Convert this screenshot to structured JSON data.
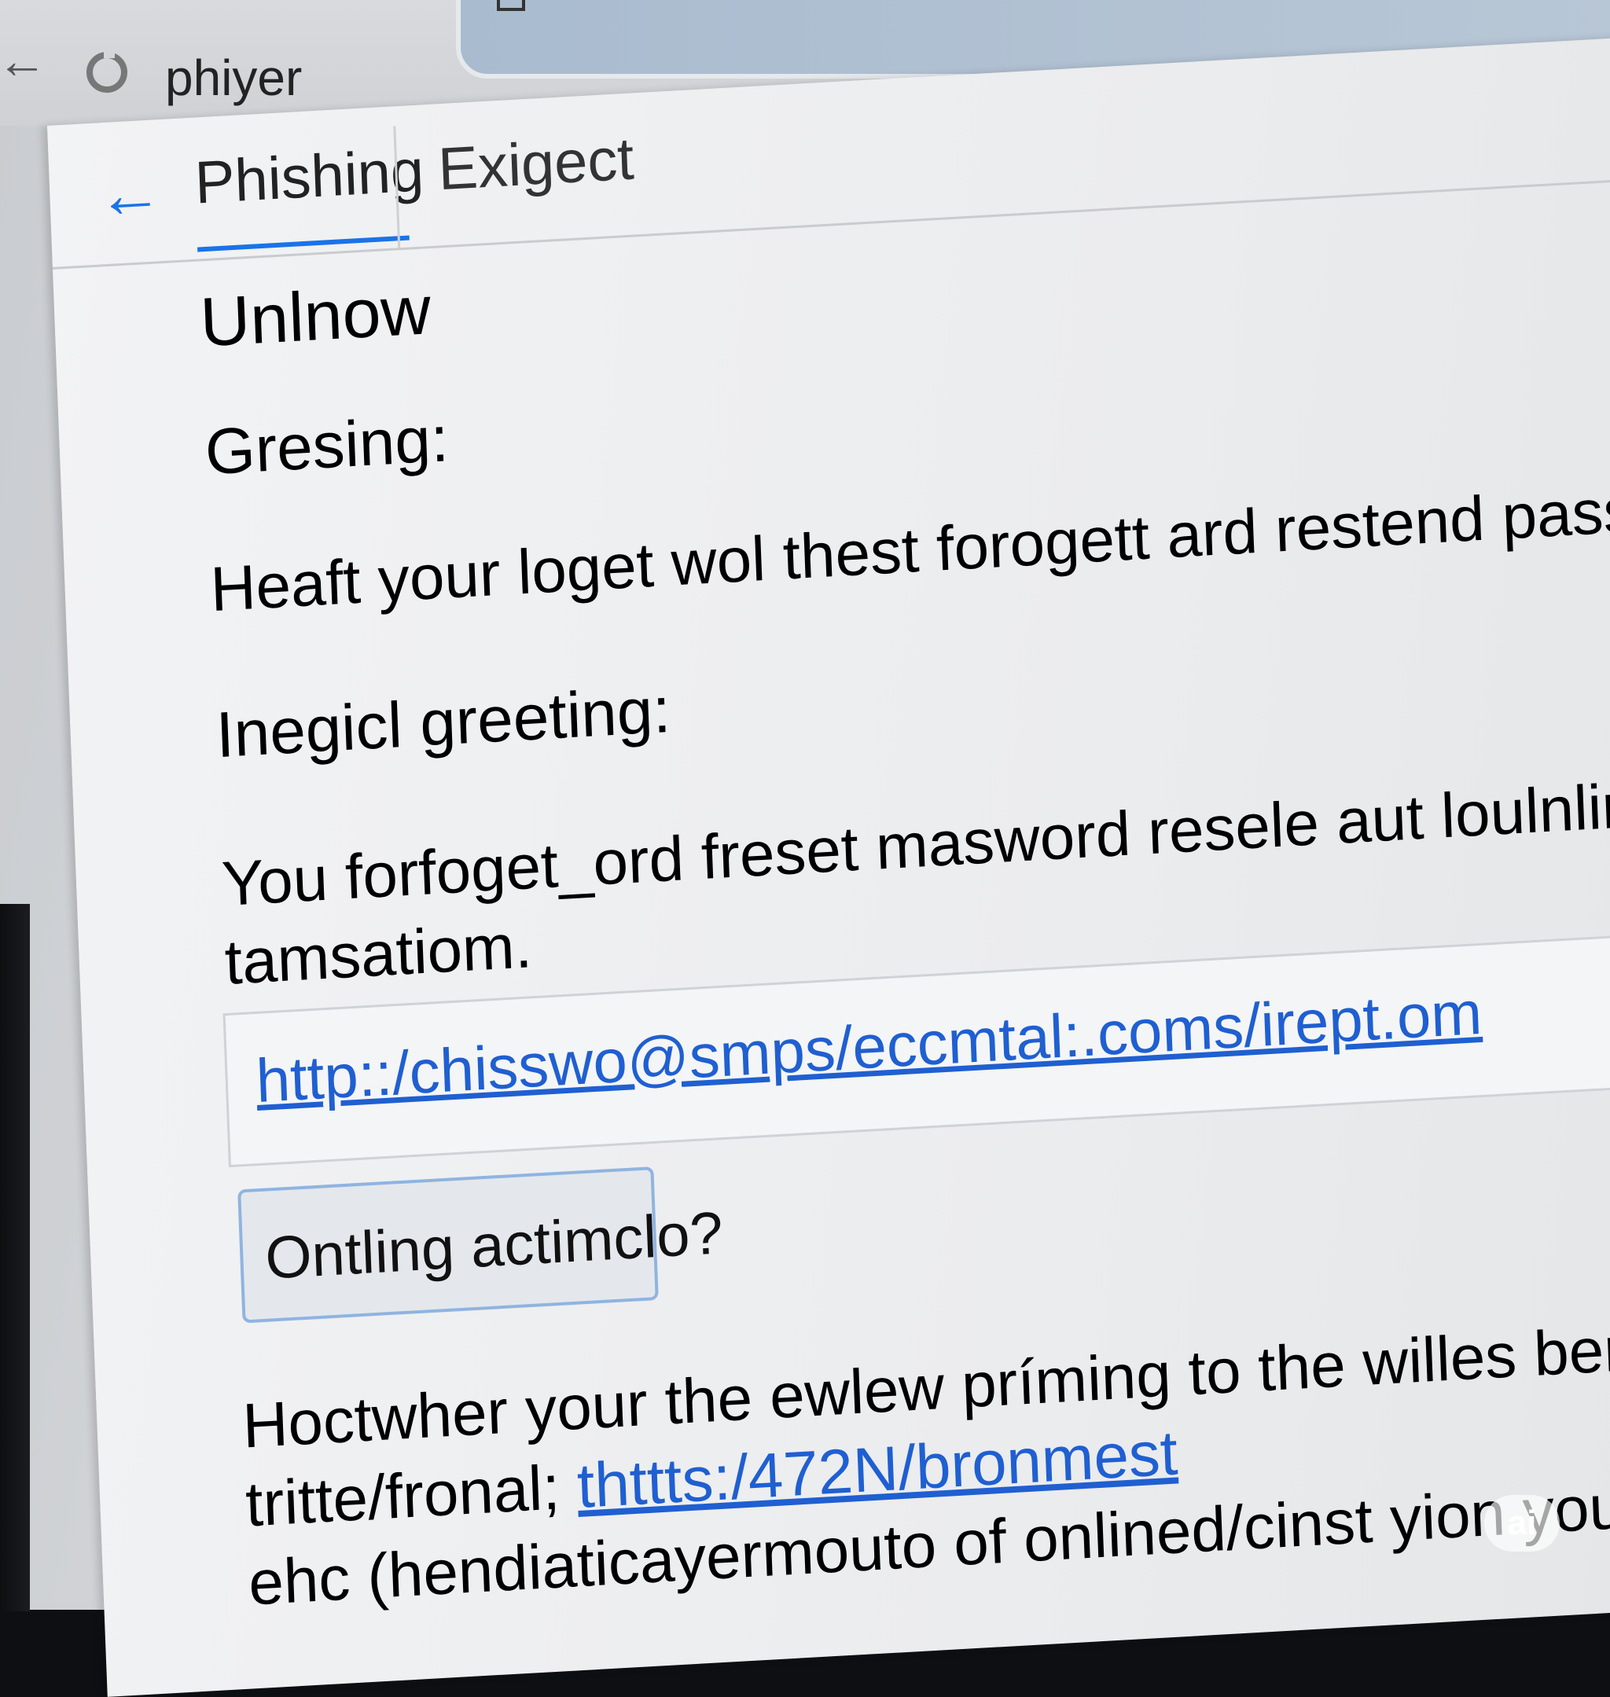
{
  "browser": {
    "address_text": "phiyer"
  },
  "mail": {
    "tabs": [
      {
        "label": "Phishing",
        "active": true
      },
      {
        "label": "Exigect",
        "active": false
      }
    ],
    "sender": "Unlnow",
    "greeting": "Gresing:",
    "body1": "Heaft your loget wol thest forogett ard restend passwrord,reset,",
    "greeting2": "Inegicl greeting:",
    "body2_line1": "You forfoget_ord freset masword resele aut loulnling oloe your de",
    "body2_line2": "tamsatiom.",
    "link_url": "http::/chisswo@smps/eccmtal:.coms/irept.om",
    "action_button": "Ontling actimclo?",
    "footer_line1": "Hoctwher your the ewlew príming to the willes bencolforen the s",
    "footer_line2_prefix": "tritte/fronal;",
    "footer_line2_link": "thttts:/472N/bronmest",
    "footer_line3": "ehc (hendiaticayermouto of onlined/cinst yion your ccodoling c"
  },
  "watermark": "ai",
  "colors": {
    "accent": "#1a73e8",
    "link": "#1f5fd1",
    "button_border": "#8fb4e0"
  }
}
